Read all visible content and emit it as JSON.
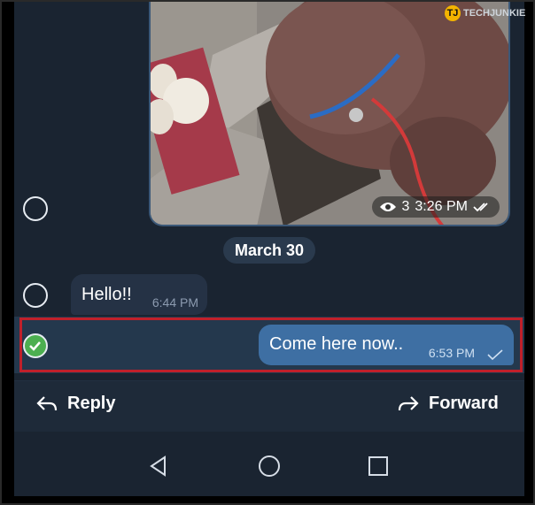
{
  "watermark": {
    "logo_text": "TECHJUNKIE",
    "badge_letters": "TJ"
  },
  "photo_message": {
    "view_count": "3",
    "time": "3:26 PM",
    "status_icon": "double-check-icon"
  },
  "date_separator": "March 30",
  "incoming_message": {
    "text": "Hello!!",
    "time": "6:44 PM"
  },
  "outgoing_message": {
    "text": "Come here now..",
    "time": "6:53 PM",
    "status_icon": "single-check-icon"
  },
  "action_bar": {
    "reply_label": "Reply",
    "forward_label": "Forward"
  },
  "colors": {
    "accent": "#3e6fa3",
    "selection_highlight": "#c0202a",
    "check_green": "#4caf50"
  }
}
